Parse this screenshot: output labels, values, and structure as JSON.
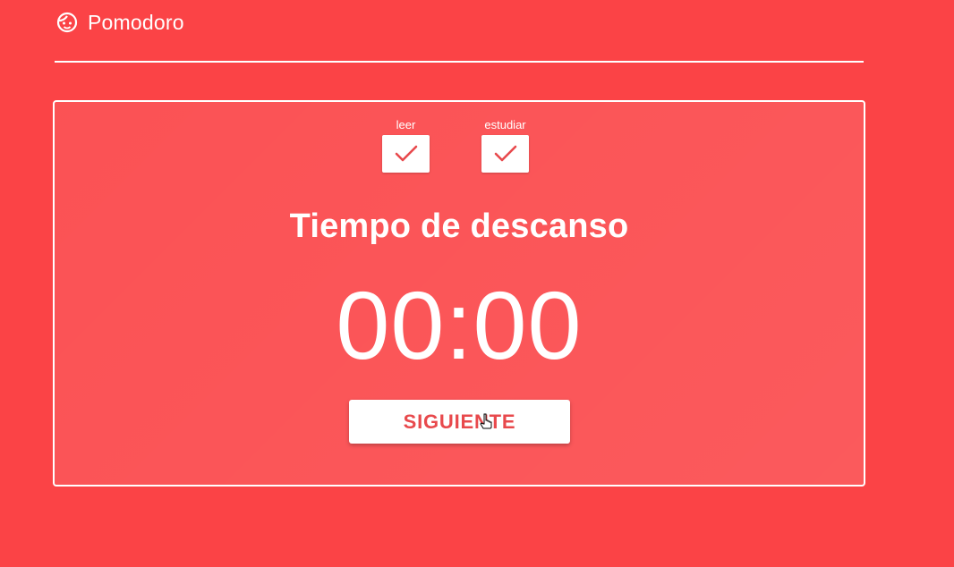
{
  "header": {
    "app_title": "Pomodoro",
    "icon": "smiley-icon"
  },
  "tasks": [
    {
      "label": "leer",
      "checked": true,
      "icon": "checkmark-icon"
    },
    {
      "label": "estudiar",
      "checked": true,
      "icon": "checkmark-icon"
    }
  ],
  "session": {
    "title": "Tiempo de descanso",
    "time": "00:00"
  },
  "actions": {
    "next_label": "SIGUIENTE"
  },
  "colors": {
    "background": "#fb4346",
    "accent": "#e8494c",
    "foreground": "#ffffff"
  }
}
